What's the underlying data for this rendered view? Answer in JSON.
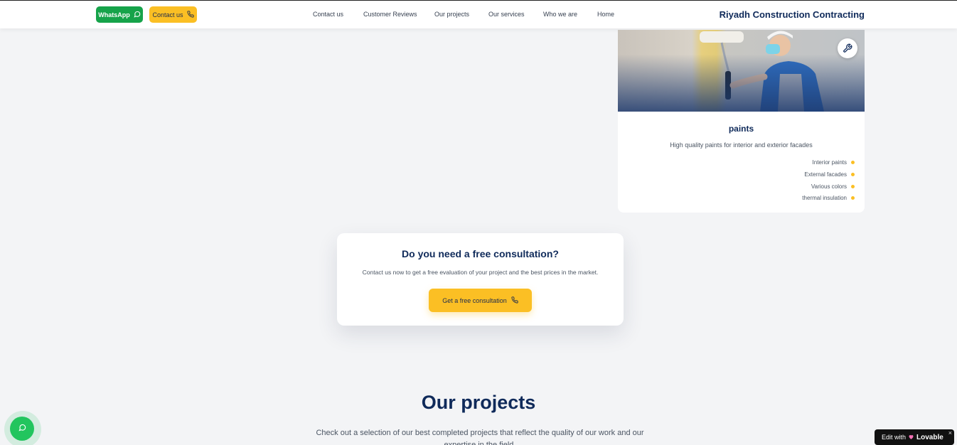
{
  "header": {
    "whatsapp_label": "WhatsApp",
    "contact_label": "Contact us",
    "nav": [
      "Contact us",
      "Customer Reviews",
      "Our projects",
      "Our services",
      "Who we are",
      "Home"
    ],
    "brand": "Riyadh Construction Contracting"
  },
  "service_card": {
    "title": "paints",
    "description": "High quality paints for interior and exterior facades",
    "features": [
      "Interior paints",
      "External facades",
      "Various colors",
      "thermal insulation"
    ],
    "badge_icon": "wrench-icon"
  },
  "consultation": {
    "title": "Do you need a free consultation?",
    "text": "Contact us now to get a free evaluation of your project and the best prices in the market.",
    "button_label": "Get a free consultation"
  },
  "projects": {
    "title": "Our projects",
    "subtitle": "Check out a selection of our best completed projects that reflect the quality of our work and our expertise in the field."
  },
  "lovable": {
    "prefix": "Edit with",
    "brand": "Lovable",
    "close": "×"
  },
  "colors": {
    "accent_yellow": "#fbbf24",
    "whatsapp_green": "#16a34a",
    "navy": "#0f2a5a"
  }
}
